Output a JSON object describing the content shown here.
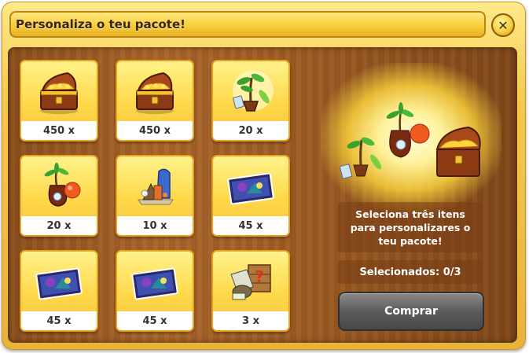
{
  "dialog": {
    "title": "Personaliza o teu pacote!",
    "close_icon": "close-icon"
  },
  "items": [
    {
      "label": "450 x",
      "icon": "treasure-chest-icon"
    },
    {
      "label": "450 x",
      "icon": "treasure-chest-icon"
    },
    {
      "label": "20 x",
      "icon": "plant-sapling-icon"
    },
    {
      "label": "20 x",
      "icon": "potion-bag-icon"
    },
    {
      "label": "10 x",
      "icon": "building-decoration-icon"
    },
    {
      "label": "45 x",
      "icon": "puzzle-picture-icon"
    },
    {
      "label": "45 x",
      "icon": "puzzle-picture-icon"
    },
    {
      "label": "45 x",
      "icon": "puzzle-picture-icon"
    },
    {
      "label": "3 x",
      "icon": "mystery-crate-icon"
    }
  ],
  "panel": {
    "description": "Seleciona três itens para personalizares o teu pacote!",
    "selected_text": "Selecionados: 0/3",
    "buy_label": "Comprar"
  },
  "colors": {
    "frame": "#f4c84a",
    "wood": "#a9652b",
    "tile": "#ffd84a",
    "buy_button": "#5c5c5c"
  }
}
